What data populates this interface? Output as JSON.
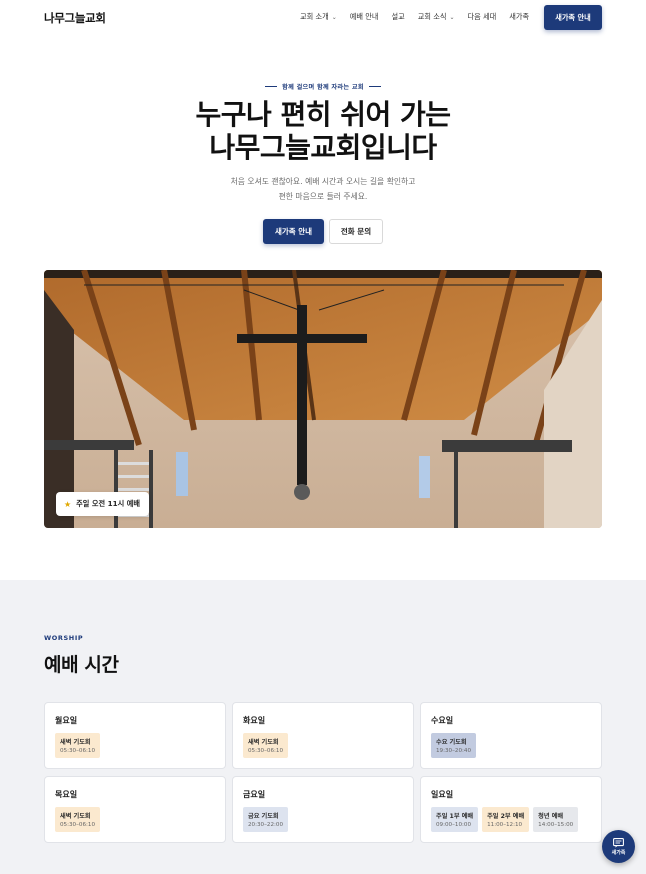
{
  "header": {
    "logo": "나무그늘교회",
    "nav": [
      {
        "label": "교회 소개",
        "dropdown": true
      },
      {
        "label": "예배 안내",
        "dropdown": false
      },
      {
        "label": "설교",
        "dropdown": false
      },
      {
        "label": "교회 소식",
        "dropdown": true
      },
      {
        "label": "다음 세대",
        "dropdown": false
      },
      {
        "label": "새가족",
        "dropdown": false
      }
    ],
    "cta": "새가족 안내"
  },
  "hero": {
    "eyebrow": "함께 걸으며 함께 자라는 교회",
    "title_line1": "누구나 편히 쉬어 가는",
    "title_line2": "나무그늘교회입니다",
    "sub_line1": "처음 오셔도 괜찮아요. 예배 시간과 오시는 길을 확인하고",
    "sub_line2": "편한 마음으로 들러 주세요.",
    "primary_button": "새가족 안내",
    "secondary_button": "전화 문의",
    "badge": "주일 오전 11시 예배",
    "badge_icon": "star-icon"
  },
  "worship": {
    "eyebrow": "WORSHIP",
    "title": "예배 시간",
    "days": [
      {
        "day": "월요일",
        "services": [
          {
            "name": "새벽 기도회",
            "time": "05:30–06:10",
            "tone": "amber"
          }
        ]
      },
      {
        "day": "화요일",
        "services": [
          {
            "name": "새벽 기도회",
            "time": "05:30–06:10",
            "tone": "amber"
          }
        ]
      },
      {
        "day": "수요일",
        "services": [
          {
            "name": "수요 기도회",
            "time": "19:30–20:40",
            "tone": "blue-strong"
          }
        ]
      },
      {
        "day": "목요일",
        "services": [
          {
            "name": "새벽 기도회",
            "time": "05:30–06:10",
            "tone": "amber"
          }
        ]
      },
      {
        "day": "금요일",
        "services": [
          {
            "name": "금요 기도회",
            "time": "20:30–22:00",
            "tone": "blue"
          }
        ]
      },
      {
        "day": "일요일",
        "services": [
          {
            "name": "주일 1부 예배",
            "time": "09:00–10:00",
            "tone": "blue"
          },
          {
            "name": "주일 2부 예배",
            "time": "11:00–12:10",
            "tone": "amber"
          },
          {
            "name": "청년 예배",
            "time": "14:00–15:00",
            "tone": "gray"
          }
        ]
      }
    ]
  },
  "fab": {
    "label": "새가족",
    "icon": "chat-icon"
  },
  "colors": {
    "accent": "#1d3a7a",
    "amber_chip": "#fbe9cf",
    "blue_chip": "#dde3ef",
    "section_bg": "#f1f2f5"
  }
}
